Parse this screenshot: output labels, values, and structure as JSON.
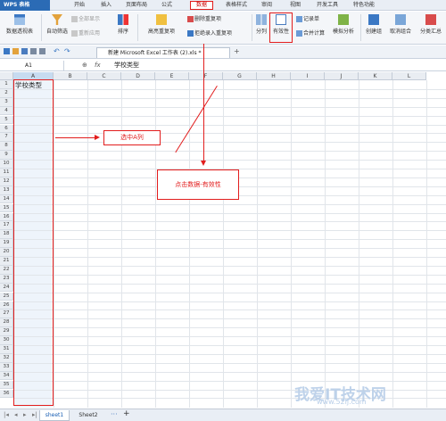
{
  "app": {
    "title": "WPS 表格"
  },
  "menu": {
    "items": [
      "开始",
      "插入",
      "页面布局",
      "公式",
      "数据",
      "表格样式",
      "审阅",
      "视图",
      "开发工具",
      "特色功能"
    ]
  },
  "ribbon": {
    "pivot": "数据透视表",
    "autofilter": "自动筛选",
    "show_all": "全部显示",
    "reapply": "重新应用",
    "sort": "排序",
    "highlight_dup": "高亮重复项",
    "remove_dup": "删除重复项",
    "reject_dup": "拒绝录入重复项",
    "split": "分列",
    "validity": "有效性",
    "record_form": "记录单",
    "consolidate": "合并计算",
    "whatif": "模拟分析",
    "group": "创建组",
    "ungroup": "取消组合",
    "subtotal": "分类汇总"
  },
  "doc_tab": {
    "label": "新建 Microsoft Excel 工作表 (2).xls *"
  },
  "formula_bar": {
    "cell_ref": "A1",
    "fx": "fx",
    "content": "学校类型"
  },
  "grid": {
    "columns": [
      "A",
      "B",
      "C",
      "D",
      "E",
      "F",
      "G",
      "H",
      "I",
      "J",
      "K",
      "L"
    ],
    "rows": [
      "1",
      "2",
      "3",
      "4",
      "5",
      "6",
      "7",
      "8",
      "9",
      "10",
      "11",
      "12",
      "13",
      "14",
      "15",
      "16",
      "17",
      "18",
      "19",
      "20",
      "21",
      "22",
      "23",
      "24",
      "25",
      "26",
      "27",
      "28",
      "29",
      "30",
      "31",
      "32",
      "33",
      "34",
      "35",
      "36"
    ],
    "cell_A1": "学校类型"
  },
  "annotations": {
    "select_col": "选中A列",
    "click_data": "点击数据-有效性",
    "color": "#e21d1d"
  },
  "sheets": {
    "tabs": [
      "sheet1",
      "Sheet2"
    ],
    "add": "+"
  },
  "watermark": {
    "main": "我爱IT技术网",
    "sub": "www.52ij.com"
  }
}
